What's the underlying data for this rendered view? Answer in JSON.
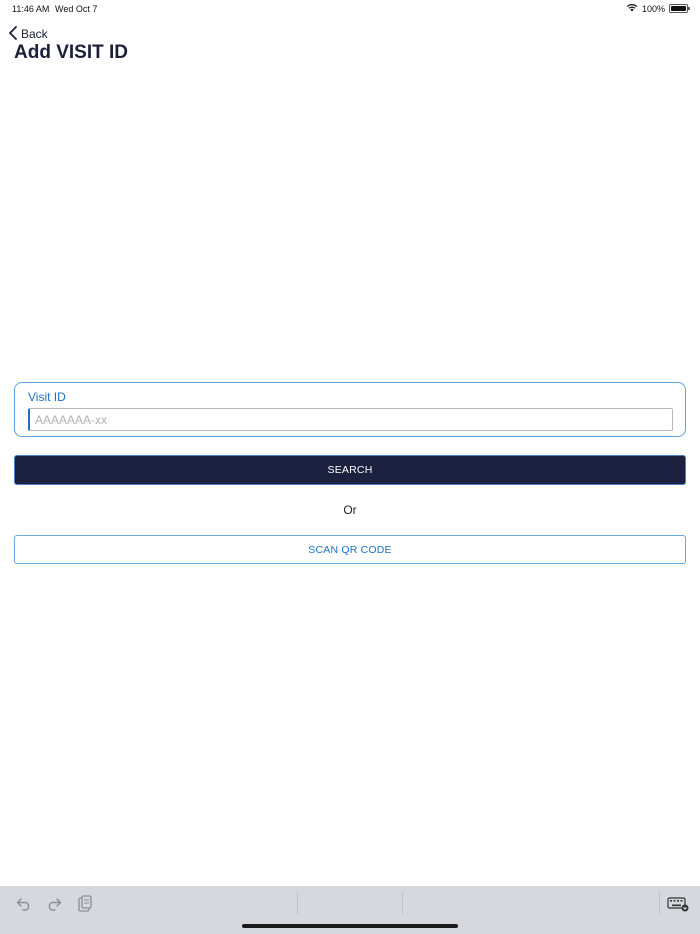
{
  "status_bar": {
    "time": "11:46 AM",
    "date": "Wed Oct 7",
    "battery_text": "100%",
    "battery_level": 1.0,
    "icons": [
      "wifi-icon",
      "battery-icon"
    ]
  },
  "nav": {
    "back_label": "Back",
    "back_icon": "chevron-left-icon",
    "title": "Add VISIT ID"
  },
  "form": {
    "visit_label": "Visit ID",
    "visit_placeholder": "AAAAAAA-xx",
    "visit_value": "",
    "search_label": "SEARCH",
    "or_text": "Or",
    "scan_label": "SCAN QR CODE"
  },
  "keyboard_bar": {
    "icons": [
      "undo-icon",
      "redo-icon",
      "paste-icon",
      "keyboard-icon"
    ]
  },
  "colors": {
    "title": "#1b1f3a",
    "accent_blue": "#1f6fc7",
    "card_border": "#5aa2e0",
    "search_bg": "#1c2140",
    "toolbar_bg": "#d6d8dd"
  }
}
